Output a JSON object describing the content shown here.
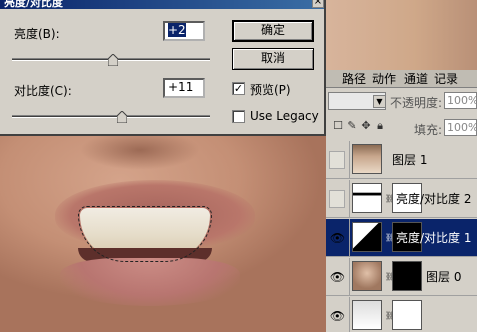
{
  "dialog": {
    "title": "亮度/对比度",
    "close_label": "×",
    "brightness_label": "亮度(B):",
    "brightness_value": "+2",
    "brightness_level": 0.51,
    "contrast_label": "对比度(C):",
    "contrast_value": "+11",
    "contrast_level": 0.555,
    "ok_label": "确定",
    "cancel_label": "取消",
    "preview_label": "预览(P)",
    "preview_checked": true,
    "legacy_label": "Use Legacy",
    "legacy_checked": false
  },
  "panel": {
    "tabs": [
      "路径",
      "动作",
      "通道",
      "记录"
    ],
    "opacity_label": "不透明度:",
    "opacity_value": "100%",
    "fill_label": "填充:",
    "fill_value": "100%",
    "layers": [
      {
        "name": "图层 1",
        "visible": false,
        "selected": false,
        "mask": false
      },
      {
        "name": "亮度/对比度 2",
        "visible": false,
        "selected": false,
        "mask": true
      },
      {
        "name": "亮度/对比度 1",
        "visible": true,
        "selected": true,
        "mask": true
      },
      {
        "name": "图层 0",
        "visible": true,
        "selected": false,
        "mask": true
      },
      {
        "name": "",
        "visible": true,
        "selected": false,
        "mask": false
      }
    ]
  }
}
